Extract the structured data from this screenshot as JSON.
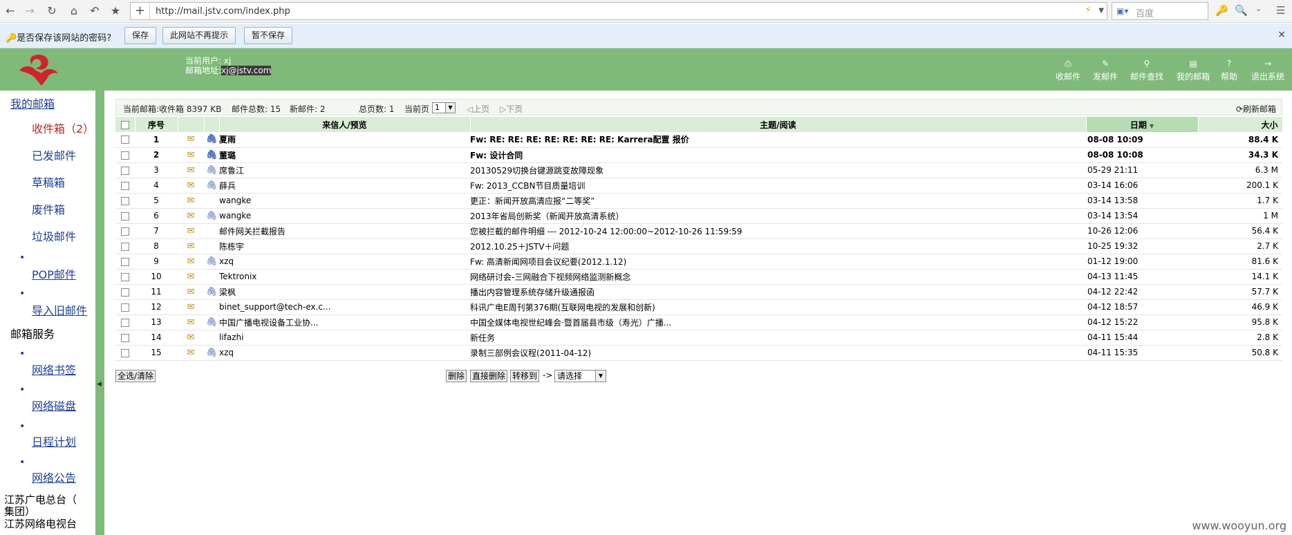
{
  "browser": {
    "url": "http://mail.jstv.com/index.php",
    "search_placeholder": "百度",
    "icons": [
      "back-icon",
      "forward-icon",
      "reload-icon",
      "home-icon",
      "undo-icon",
      "bookmark-star-icon"
    ]
  },
  "password_bar": {
    "prompt": "是否保存该网站的密码?",
    "save": "保存",
    "never": "此网站不再提示",
    "not_now": "暂不保存",
    "close": "×"
  },
  "header": {
    "user_label": "当前用户:",
    "user_value": "xj",
    "email_label": "邮箱地址:",
    "email_value": "xj@jstv.com",
    "nav": [
      {
        "label": "收邮件",
        "icon": "inbox-icon"
      },
      {
        "label": "发邮件",
        "icon": "compose-icon"
      },
      {
        "label": "邮件查找",
        "icon": "search-mail-icon"
      },
      {
        "label": "我的邮箱",
        "icon": "mailbox-icon"
      },
      {
        "label": "帮助",
        "icon": "help-icon"
      },
      {
        "label": "退出系统",
        "icon": "logout-icon"
      }
    ]
  },
  "sidebar": {
    "my_mailbox": "我的邮箱",
    "folders": [
      "收件箱（2）",
      "已发邮件",
      "草稿箱",
      "废件箱",
      "垃圾邮件"
    ],
    "pop": "POP邮件",
    "import": "导入旧邮件",
    "services_title": "邮箱服务",
    "services": [
      "网络书签",
      "网络磁盘",
      "日程计划",
      "网络公告"
    ],
    "org_line1": "江苏广电总台（",
    "org_line2": "集团）",
    "org_line3": "江苏网络电视台"
  },
  "info": {
    "current_box": "当前邮箱:收件箱",
    "size": "8397 KB",
    "total": "邮件总数: 15",
    "new": "新邮件: 2",
    "pages": "总页数: 1",
    "current_page_label": "当前页",
    "current_page": "1",
    "prev": "上页",
    "next": "下页",
    "refresh": "刷新邮箱"
  },
  "table": {
    "headers": {
      "num": "序号",
      "from": "来信人/预览",
      "subject": "主题/阅读",
      "date": "日期",
      "size": "大小"
    },
    "rows": [
      {
        "num": "1",
        "from": "夏雨",
        "subject": "Fw: RE: RE: RE: RE: RE: RE: RE: Karrera配置 报价",
        "date": "08-08 10:09",
        "size": "88.4 K",
        "unread": true,
        "attach": true
      },
      {
        "num": "2",
        "from": "董璐",
        "subject": "Fw: 设计合同",
        "date": "08-08 10:08",
        "size": "34.3 K",
        "unread": true,
        "attach": true
      },
      {
        "num": "3",
        "from": "席鲁江",
        "subject": "20130529切换台键源跳变故障现象",
        "date": "05-29 21:11",
        "size": "6.3 M",
        "unread": false,
        "attach": true
      },
      {
        "num": "4",
        "from": "薛兵",
        "subject": "Fw: 2013_CCBN节目质量培训",
        "date": "03-14 16:06",
        "size": "200.1 K",
        "unread": false,
        "attach": true
      },
      {
        "num": "5",
        "from": "wangke",
        "subject": "更正：新闻开放高清应报“二等奖”",
        "date": "03-14 13:58",
        "size": "1.7 K",
        "unread": false,
        "attach": false
      },
      {
        "num": "6",
        "from": "wangke",
        "subject": "2013年省局创新奖（新闻开放高清系统）",
        "date": "03-14 13:54",
        "size": "1 M",
        "unread": false,
        "attach": true
      },
      {
        "num": "7",
        "from": "邮件网关拦截报告",
        "subject": "您被拦截的邮件明细 --- 2012-10-24 12:00:00~2012-10-26 11:59:59",
        "date": "10-26 12:06",
        "size": "56.4 K",
        "unread": false,
        "attach": false
      },
      {
        "num": "8",
        "from": "陈栋宇",
        "subject": "2012.10.25＋JSTV＋问题",
        "date": "10-25 19:32",
        "size": "2.7 K",
        "unread": false,
        "attach": false
      },
      {
        "num": "9",
        "from": "xzq",
        "subject": "Fw: 高清新闻网项目会议纪要(2012.1.12)",
        "date": "01-12 19:00",
        "size": "81.6 K",
        "unread": false,
        "attach": true
      },
      {
        "num": "10",
        "from": "Tektronix",
        "subject": "网络研讨会-三网融合下视频网络监测新概念",
        "date": "04-13 11:45",
        "size": "14.1 K",
        "unread": false,
        "attach": false
      },
      {
        "num": "11",
        "from": "梁枫",
        "subject": "播出内容管理系统存储升级通报函",
        "date": "04-12 22:42",
        "size": "57.7 K",
        "unread": false,
        "attach": true
      },
      {
        "num": "12",
        "from": "binet_support@tech-ex.c...",
        "subject": "科讯广电E周刊第376期(互联网电视的发展和创新)",
        "date": "04-12 18:57",
        "size": "46.9 K",
        "unread": false,
        "attach": false
      },
      {
        "num": "13",
        "from": "中国广播电视设备工业协...",
        "subject": "中国全媒体电视世纪峰会·暨首届县市级（寿光）广播...",
        "date": "04-12 15:22",
        "size": "95.8 K",
        "unread": false,
        "attach": true
      },
      {
        "num": "14",
        "from": "lifazhi",
        "subject": "新任务",
        "date": "04-11 15:44",
        "size": "2.8 K",
        "unread": false,
        "attach": false
      },
      {
        "num": "15",
        "from": "xzq",
        "subject": "录制三部例会议程(2011-04-12)",
        "date": "04-11 15:35",
        "size": "50.8 K",
        "unread": false,
        "attach": true
      }
    ]
  },
  "actions": {
    "select_all": "全选/清除",
    "delete": "删除",
    "direct_delete": "直接删除",
    "move_to": "转移到",
    "arrow": "->",
    "select_placeholder": "请选择"
  },
  "watermark": "www.wooyun.org",
  "colors": {
    "header_green": "#7fba7a",
    "link_blue": "#1c3f94",
    "accent_red": "#b5282a"
  }
}
